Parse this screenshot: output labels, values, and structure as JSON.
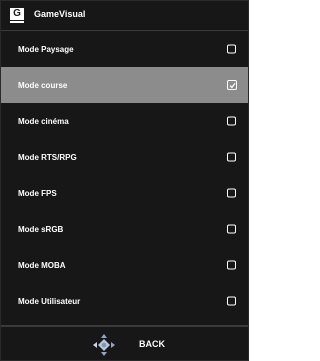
{
  "header": {
    "icon_letter": "G",
    "title": "GameVisual"
  },
  "items": [
    {
      "label": "Mode Paysage",
      "selected": false
    },
    {
      "label": "Mode course",
      "selected": true
    },
    {
      "label": "Mode cinéma",
      "selected": false
    },
    {
      "label": "Mode RTS/RPG",
      "selected": false
    },
    {
      "label": "Mode FPS",
      "selected": false
    },
    {
      "label": "Mode sRGB",
      "selected": false
    },
    {
      "label": "Mode MOBA",
      "selected": false
    },
    {
      "label": "Mode Utilisateur",
      "selected": false
    }
  ],
  "footer": {
    "back_label": "BACK",
    "nav_icon": "dpad-icon"
  },
  "colors": {
    "background": "#171717",
    "selected_row": "#8c8c8c",
    "text": "#ffffff"
  }
}
